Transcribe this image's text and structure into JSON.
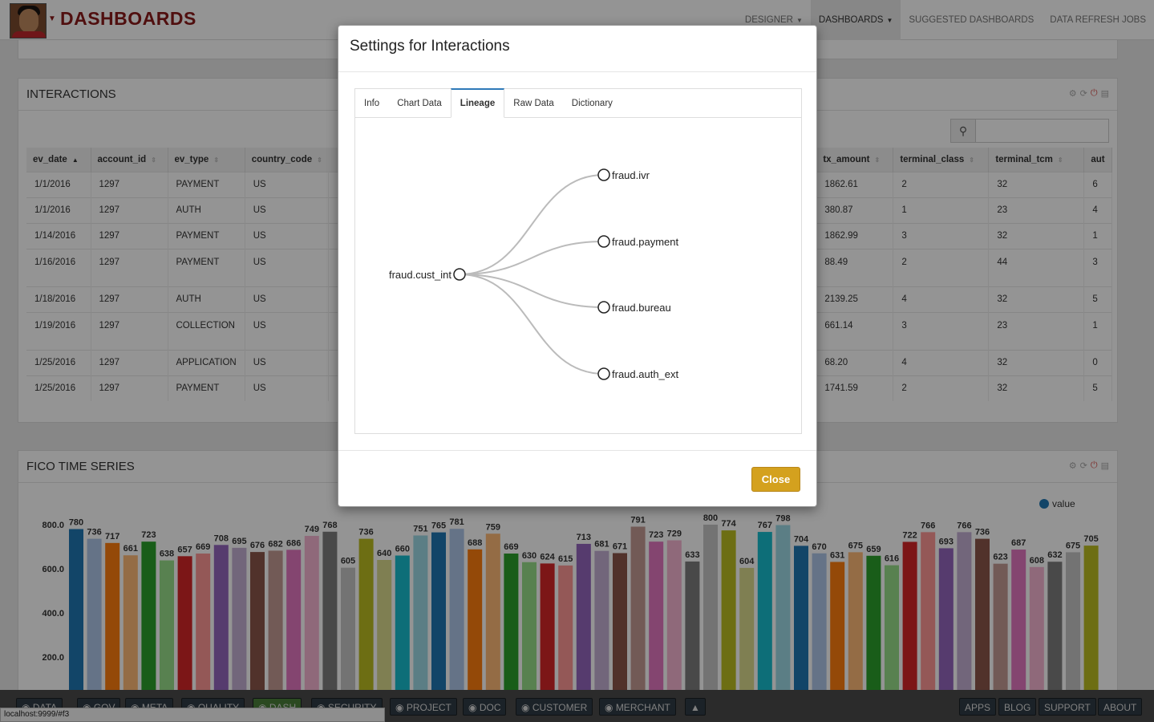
{
  "app": {
    "brand": "DASHBOARDS"
  },
  "topnav": [
    {
      "label": "DESIGNER",
      "caret": true,
      "active": false
    },
    {
      "label": "DASHBOARDS",
      "caret": true,
      "active": true
    },
    {
      "label": "SUGGESTED DASHBOARDS",
      "caret": false,
      "active": false
    },
    {
      "label": "DATA REFRESH JOBS",
      "caret": false,
      "active": false
    }
  ],
  "interactions": {
    "title": "INTERACTIONS",
    "columns": [
      "ev_date",
      "account_id",
      "ev_type",
      "country_code",
      "tx_amount",
      "terminal_class",
      "terminal_tcm",
      "aut"
    ],
    "rows": [
      [
        "1/1/2016",
        "1297",
        "PAYMENT",
        "US",
        "1862.61",
        "2",
        "32",
        "6"
      ],
      [
        "1/1/2016",
        "1297",
        "AUTH",
        "US",
        "380.87",
        "1",
        "23",
        "4"
      ],
      [
        "1/14/2016",
        "1297",
        "PAYMENT",
        "US",
        "1862.99",
        "3",
        "32",
        "1"
      ],
      [
        "1/16/2016",
        "1297",
        "PAYMENT",
        "US",
        "88.49",
        "2",
        "44",
        "3"
      ],
      [
        "1/18/2016",
        "1297",
        "AUTH",
        "US",
        "2139.25",
        "4",
        "32",
        "5"
      ],
      [
        "1/19/2016",
        "1297",
        "COLLECTION",
        "US",
        "661.14",
        "3",
        "23",
        "1"
      ],
      [
        "1/25/2016",
        "1297",
        "APPLICATION",
        "US",
        "68.20",
        "4",
        "32",
        "0"
      ],
      [
        "1/25/2016",
        "1297",
        "PAYMENT",
        "US",
        "1741.59",
        "2",
        "32",
        "5"
      ]
    ]
  },
  "fico": {
    "title": "FICO TIME SERIES"
  },
  "chart_data": {
    "type": "bar",
    "title": "FICO TIME SERIES",
    "legend": "value",
    "legend_position": "top-right",
    "yticks": [
      "800.0",
      "600.0",
      "400.0",
      "200.0"
    ],
    "ylim": [
      0,
      800
    ],
    "grid": false,
    "values": [
      780,
      736,
      717,
      661,
      723,
      638,
      657,
      669,
      708,
      695,
      676,
      682,
      686,
      749,
      768,
      605,
      736,
      640,
      660,
      751,
      765,
      781,
      688,
      759,
      669,
      630,
      624,
      615,
      713,
      681,
      671,
      791,
      723,
      729,
      633,
      800,
      774,
      604,
      767,
      798,
      704,
      670,
      631,
      675,
      659,
      616,
      722,
      766,
      693,
      766,
      736,
      623,
      687,
      608,
      632,
      675,
      705
    ],
    "colors": [
      "#1f77b4",
      "#aec7e8",
      "#ff7f0e",
      "#ffbb78",
      "#2ca02c",
      "#98df8a",
      "#d62728",
      "#ff9896",
      "#9467bd",
      "#c5b0d5",
      "#8c564b",
      "#c49c94",
      "#e377c2",
      "#f7b6d2",
      "#7f7f7f",
      "#c7c7c7",
      "#bcbd22",
      "#dbdb8d",
      "#17becf",
      "#9edae5"
    ]
  },
  "modal": {
    "title": "Settings for Interactions",
    "tabs": [
      "Info",
      "Chart Data",
      "Lineage",
      "Raw Data",
      "Dictionary"
    ],
    "active_tab": "Lineage",
    "lineage": {
      "root": "fraud.cust_int",
      "children": [
        "fraud.ivr",
        "fraud.payment",
        "fraud.bureau",
        "fraud.auth_ext"
      ]
    },
    "close_label": "Close"
  },
  "footer": {
    "left": [
      "DATA",
      "GOV",
      "META",
      "QUALITY",
      "DASH",
      "SECURITY",
      "PROJECT",
      "DOC",
      "CUSTOMER",
      "MERCHANT"
    ],
    "right": [
      "APPS",
      "BLOG",
      "SUPPORT",
      "ABOUT"
    ]
  },
  "status_url": "localhost:9999/#f3"
}
